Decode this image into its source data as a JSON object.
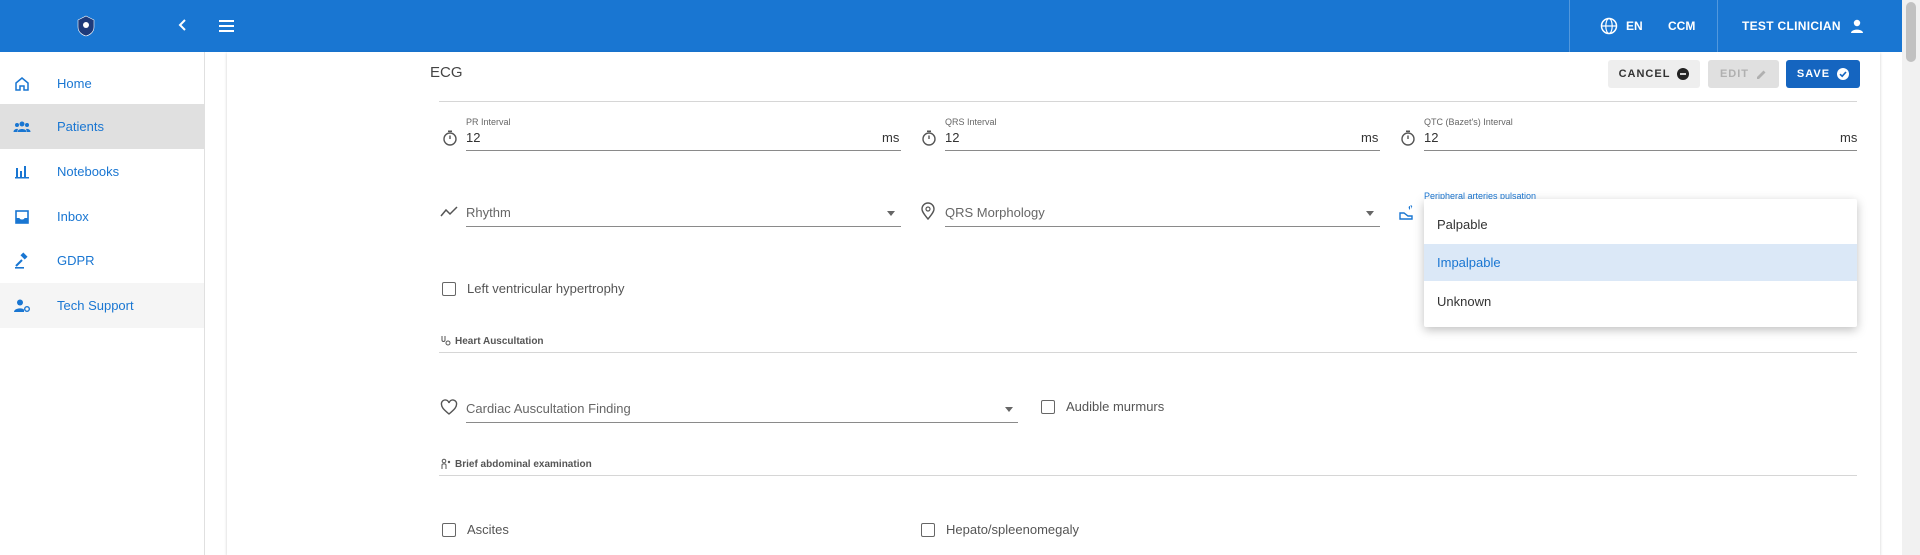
{
  "appbar": {
    "language": "EN",
    "ccm": "CCM",
    "user": "TEST CLINICIAN"
  },
  "sidebar": {
    "items": [
      {
        "label": "Home",
        "icon": "home-icon"
      },
      {
        "label": "Patients",
        "icon": "patients-icon"
      },
      {
        "label": "Notebooks",
        "icon": "bar-chart-icon"
      },
      {
        "label": "Inbox",
        "icon": "inbox-icon"
      },
      {
        "label": "GDPR",
        "icon": "gavel-icon"
      },
      {
        "label": "Tech Support",
        "icon": "support-agent-icon"
      }
    ]
  },
  "section": {
    "title": "ECG",
    "buttons": {
      "cancel": "CANCEL",
      "edit": "EDIT",
      "save": "SAVE"
    }
  },
  "ecg": {
    "pr": {
      "label": "PR Interval",
      "value": "12",
      "unit": "ms"
    },
    "qrs": {
      "label": "QRS Interval",
      "value": "12",
      "unit": "ms"
    },
    "qtc": {
      "label": "QTC (Bazet's) Interval",
      "value": "12",
      "unit": "ms"
    },
    "rhythm": {
      "placeholder": "Rhythm"
    },
    "qrs_morphology": {
      "placeholder": "QRS Morphology"
    },
    "peripheral": {
      "label": "Peripheral arteries pulsation",
      "options": [
        "Palpable",
        "Impalpable",
        "Unknown"
      ],
      "selected": "Impalpable"
    },
    "lvh": "Left ventricular hypertrophy"
  },
  "heart": {
    "title": "Heart Auscultation",
    "finding": "Cardiac Auscultation Finding",
    "murmurs": "Audible murmurs"
  },
  "abdominal": {
    "title": "Brief abdominal examination",
    "ascites": "Ascites",
    "hepato": "Hepato/spleenomegaly"
  },
  "colors": {
    "primary": "#1976d2",
    "save": "#1565c0",
    "selected_bg": "#dbe8f7"
  }
}
